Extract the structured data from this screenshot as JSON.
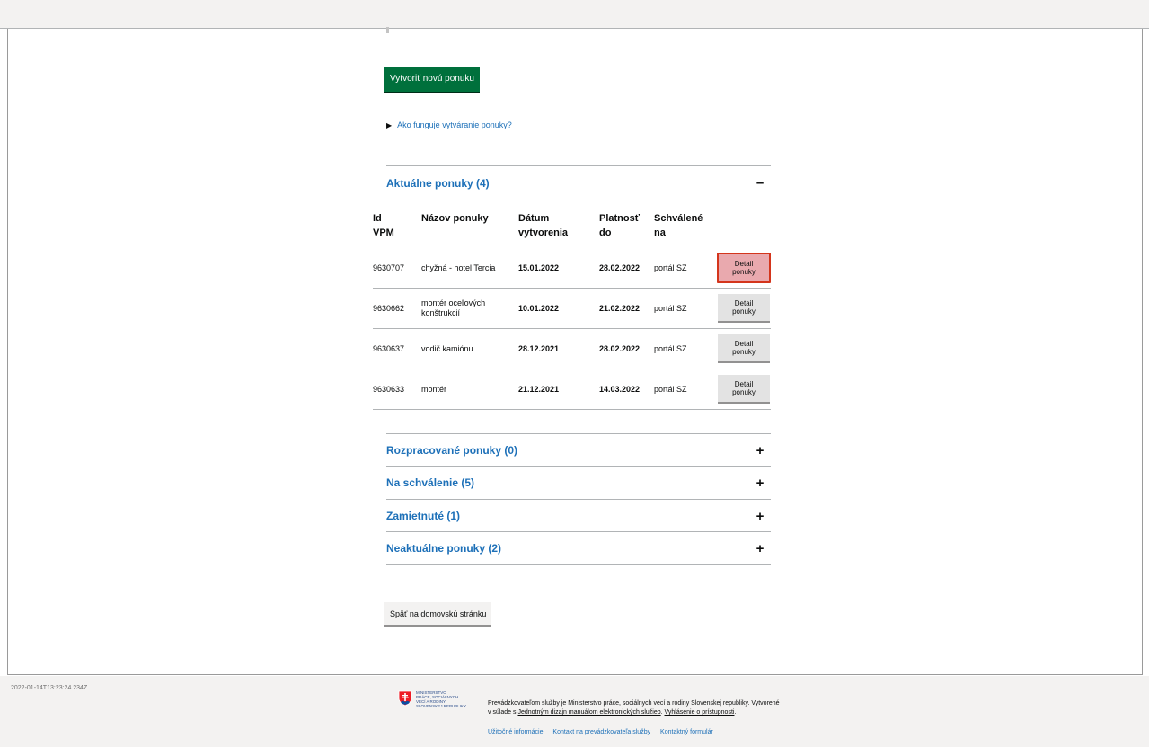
{
  "create_button": "Vytvoriť novú ponuku",
  "howto_link": "Ako funguje vytváranie ponuky?",
  "current_section": {
    "title": "Aktuálne ponuky (4)",
    "toggle": "–",
    "columns": {
      "id": [
        "Id",
        "VPM"
      ],
      "name": [
        "Názov ponuky"
      ],
      "created": [
        "Dátum",
        "vytvorenia"
      ],
      "valid": [
        "Platnosť",
        "do"
      ],
      "approved": [
        "Schválené",
        "na"
      ]
    },
    "rows": [
      {
        "id": "9630707",
        "name": "chyžná - hotel Tercia",
        "created": "15.01.2022",
        "valid": "28.02.2022",
        "approved": "portál SZ",
        "detail_l1": "Detail",
        "detail_l2": "ponuky"
      },
      {
        "id": "9630662",
        "name": "montér oceľových konštrukcií",
        "created": "10.01.2022",
        "valid": "21.02.2022",
        "approved": "portál SZ",
        "detail_l1": "Detail",
        "detail_l2": "ponuky"
      },
      {
        "id": "9630637",
        "name": "vodič kamiónu",
        "created": "28.12.2021",
        "valid": "28.02.2022",
        "approved": "portál SZ",
        "detail_l1": "Detail",
        "detail_l2": "ponuky"
      },
      {
        "id": "9630633",
        "name": "montér",
        "created": "21.12.2021",
        "valid": "14.03.2022",
        "approved": "portál SZ",
        "detail_l1": "Detail",
        "detail_l2": "ponuky"
      }
    ]
  },
  "collapsed_sections": [
    {
      "title": "Rozpracované ponuky (0)",
      "toggle": "+"
    },
    {
      "title": "Na schválenie (5)",
      "toggle": "+"
    },
    {
      "title": "Zamietnuté (1)",
      "toggle": "+"
    },
    {
      "title": "Neaktuálne ponuky (2)",
      "toggle": "+"
    }
  ],
  "back_button": "Späť na domovskú stránku",
  "footer": {
    "timestamp": "2022-01-14T13:23:24.234Z",
    "logo_lines": [
      "Ministerstvo",
      "práce, sociálnych",
      "vecí a rodiny",
      "Slovenskej republiky"
    ],
    "text_part1": "Prevádzkovateľom služby je Ministerstvo práce, sociálnych vecí a rodiny Slovenskej republiky. Vytvorené v súlade s ",
    "text_link1": "Jednotným dizajn manuálom elektronických služieb",
    "text_part2": ". ",
    "text_link2": "Vyhlásenie o prístupnosti",
    "text_part3": ".",
    "links": [
      "Užitočné informácie",
      "Kontakt na prevádzkovateľa služby",
      "Kontaktný formulár"
    ]
  },
  "colors": {
    "primary_green": "#00703c",
    "link_blue": "#1d70b8",
    "active_red": "#d4351c"
  }
}
